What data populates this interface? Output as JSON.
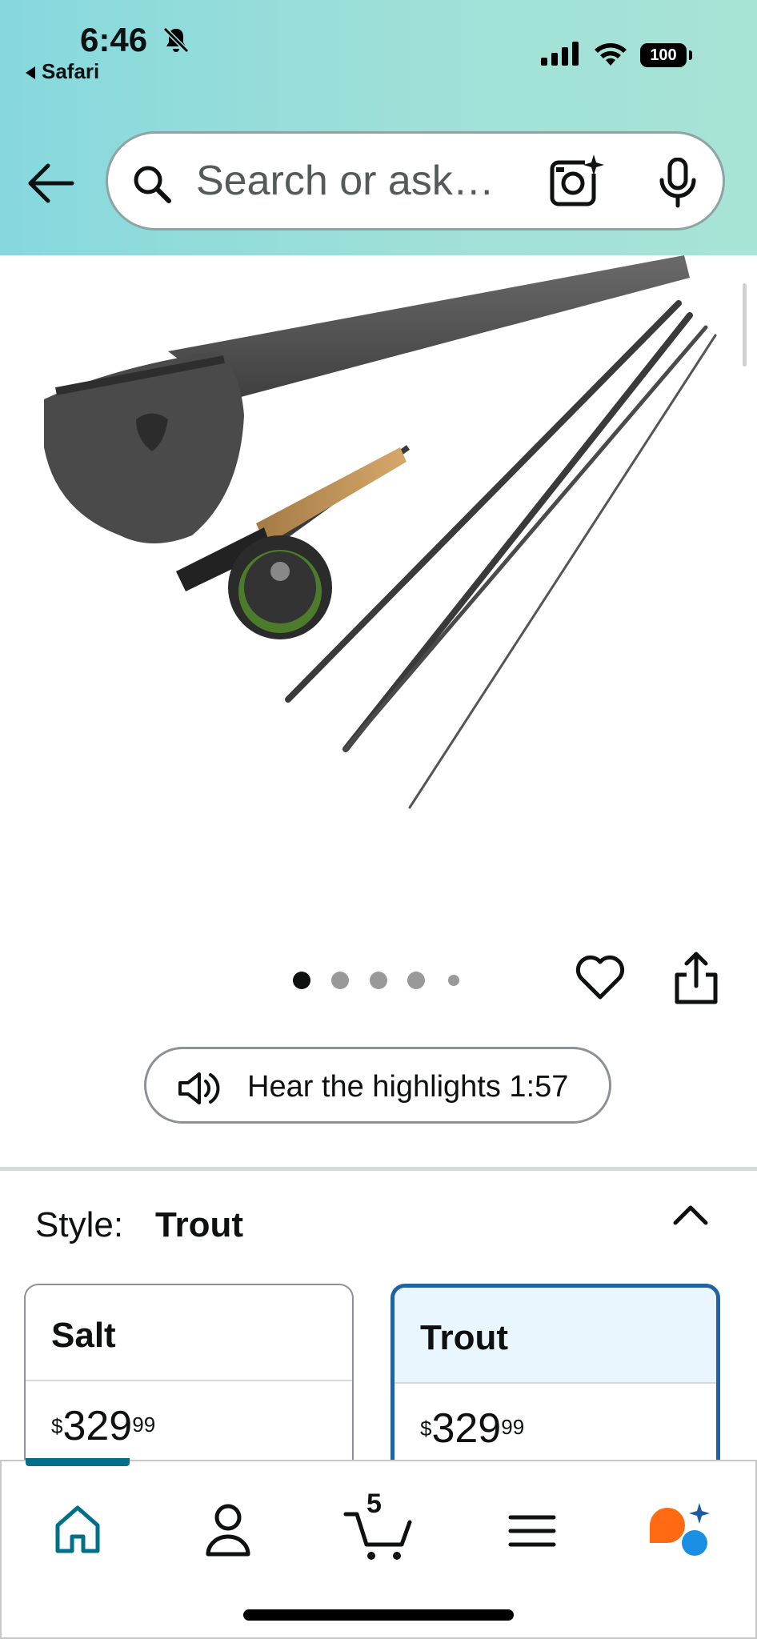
{
  "status_bar": {
    "time": "6:46",
    "back_app": "Safari",
    "battery": "100"
  },
  "search": {
    "placeholder": "Search or ask…"
  },
  "image_carousel": {
    "total_images": 5,
    "current_index": 1
  },
  "highlights": {
    "label": "Hear the highlights 1:57"
  },
  "style_selector": {
    "label": "Style:",
    "selected": "Trout",
    "options": [
      {
        "name": "Salt",
        "price_dollars": "329",
        "price_cents": "99",
        "currency": "$",
        "selected": false
      },
      {
        "name": "Trout",
        "price_dollars": "329",
        "price_cents": "99",
        "currency": "$",
        "selected": true
      }
    ]
  },
  "bottom_nav": {
    "items": [
      "home-icon",
      "account-icon",
      "cart-icon",
      "menu-icon",
      "rufus-icon"
    ],
    "cart_count": "5",
    "active": "home-icon"
  },
  "colors": {
    "accent": "#00708a",
    "selected_border": "#2162a1",
    "header_gradient_start": "#86d8de",
    "header_gradient_end": "#a8e4d6"
  }
}
